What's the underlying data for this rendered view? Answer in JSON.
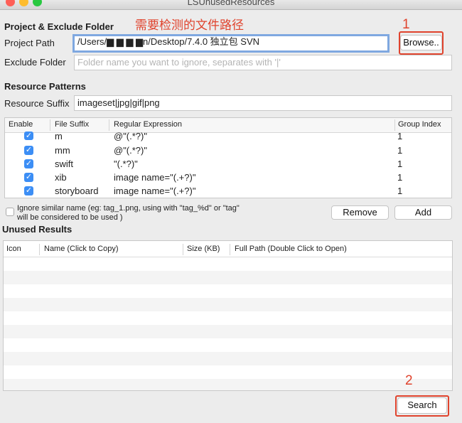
{
  "window": {
    "title": "LSUnusedResources"
  },
  "annotations": {
    "path_note": "需要检测的文件路径",
    "marker_1": "1",
    "marker_2": "2",
    "color": "#e0432d"
  },
  "project": {
    "section_title": "Project & Exclude Folder",
    "path_label": "Project Path",
    "path_value": "/Users/▆ ▆ ▆ ▆n/Desktop/7.4.0 独立包 SVN",
    "browse_label": "Browse..",
    "exclude_label": "Exclude Folder",
    "exclude_placeholder": "Folder name you want to ignore, separates with '|'"
  },
  "patterns": {
    "section_title": "Resource Patterns",
    "suffix_label": "Resource Suffix",
    "suffix_value": "imageset|jpg|gif|png",
    "columns": [
      "Enable",
      "File Suffix",
      "Regular Expression",
      "Group Index"
    ],
    "rows": [
      {
        "enabled": true,
        "suffix": "m",
        "regex": "@\"(.*?)\"",
        "group": "1"
      },
      {
        "enabled": true,
        "suffix": "mm",
        "regex": "@\"(.*?)\"",
        "group": "1"
      },
      {
        "enabled": true,
        "suffix": "swift",
        "regex": "\"(.*?)\"",
        "group": "1"
      },
      {
        "enabled": true,
        "suffix": "xib",
        "regex": "image name=\"(.+?)\"",
        "group": "1"
      },
      {
        "enabled": true,
        "suffix": "storyboard",
        "regex": "image name=\"(.+?)\"",
        "group": "1"
      }
    ],
    "ignore_similar_line1": "Ignore similar name (eg: tag_1.png, using with \"tag_%d\" or \"tag\"",
    "ignore_similar_line2": "will be considered to be used )",
    "remove_label": "Remove",
    "add_label": "Add"
  },
  "results": {
    "section_title": "Unused Results",
    "columns": [
      "Icon",
      "Name (Click to Copy)",
      "Size (KB)",
      "Full Path (Double Click to Open)"
    ]
  },
  "search_label": "Search",
  "colors": {
    "accent": "#3c8ef5",
    "focus_ring": "#7fa8e0",
    "close": "#fe5f57",
    "minimize": "#febc2e",
    "zoom": "#28c840"
  }
}
